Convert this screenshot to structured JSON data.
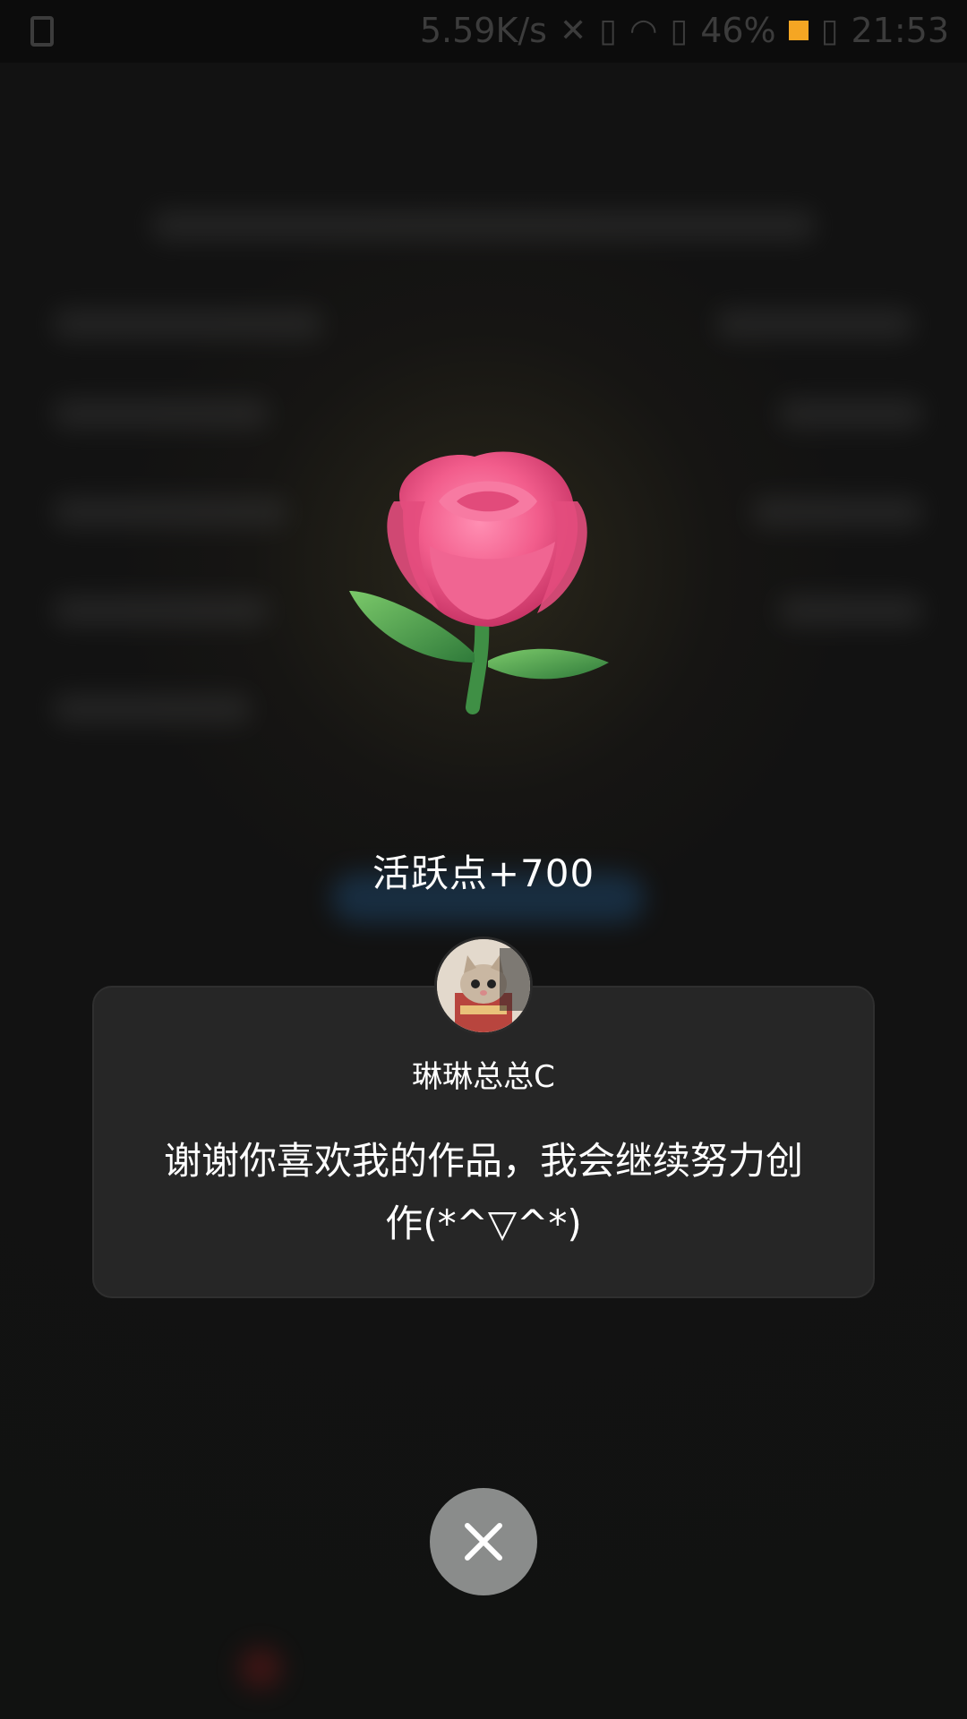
{
  "status_bar": {
    "speed": "5.59K/s",
    "battery": "46%",
    "time": "21:53",
    "icons": [
      "notification-icon",
      "mute-icon",
      "vibrate-icon",
      "wifi-icon",
      "sim-icon",
      "battery-icon"
    ],
    "accent_color": "#f5a623"
  },
  "gift": {
    "name": "rose-icon",
    "activity_points": "活跃点+700"
  },
  "message_card": {
    "username": "琳琳总总C",
    "message": "谢谢你喜欢我的作品，我会继续努力创作(*^▽^*)"
  },
  "close_button": {
    "icon": "close-icon"
  }
}
